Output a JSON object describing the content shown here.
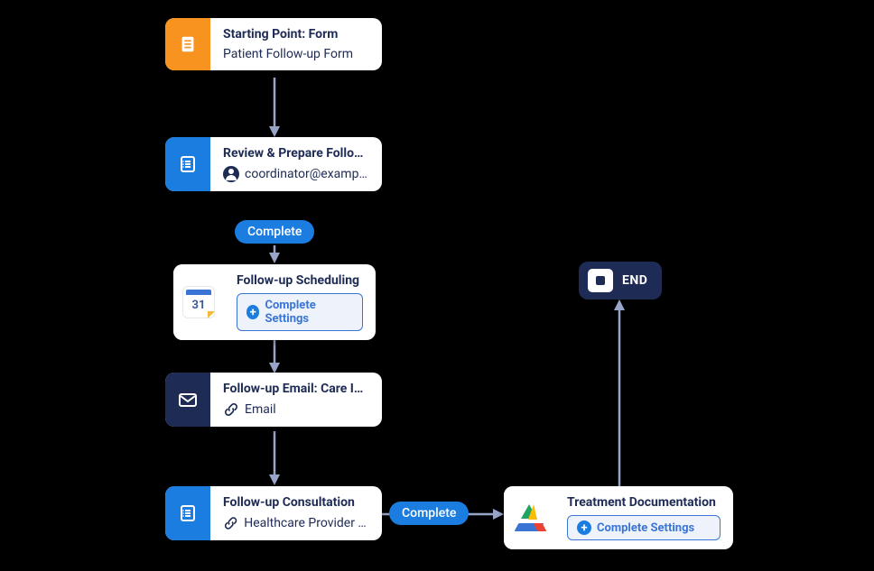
{
  "nodes": {
    "start": {
      "title": "Starting Point: Form",
      "subtitle": "Patient Follow-up Form"
    },
    "review": {
      "title": "Review & Prepare Follow-up ...",
      "subtitle": "coordinator@example..."
    },
    "scheduling": {
      "title": "Follow-up Scheduling",
      "button": "Complete Settings",
      "cal_day": "31"
    },
    "email": {
      "title": "Follow-up Email: Care Instru...",
      "subtitle": "Email"
    },
    "consult": {
      "title": "Follow-up Consultation",
      "subtitle": "Healthcare Provider E..."
    },
    "treatment": {
      "title": "Treatment Documentation",
      "button": "Complete Settings"
    },
    "end": {
      "label": "END"
    }
  },
  "pills": {
    "complete1": "Complete",
    "complete2": "Complete"
  }
}
